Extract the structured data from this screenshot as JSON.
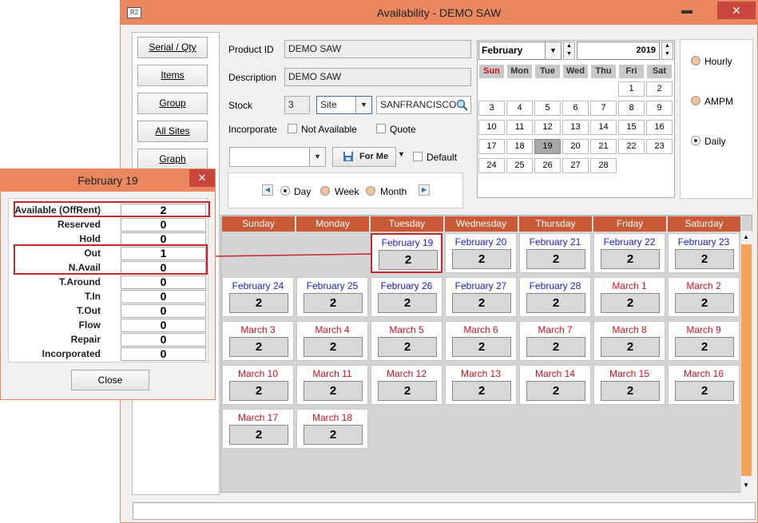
{
  "window": {
    "title": "Availability - DEMO SAW",
    "logo": "R2",
    "minimize_icon": "minimize-icon",
    "close_icon": "close-icon"
  },
  "nav": [
    "Serial / Qty",
    "Items",
    "Group",
    "All Sites",
    "Graph"
  ],
  "info": {
    "product_id_label": "Product ID",
    "product_id": "DEMO SAW",
    "description_label": "Description",
    "description": "DEMO SAW",
    "stock_label": "Stock",
    "stock_qty": "3",
    "stock_type": "Site",
    "stock_site": "SANFRANCISCO",
    "incorporate_label": "Incorporate",
    "not_available_label": "Not Available",
    "quote_label": "Quote",
    "for_me_label": "For Me",
    "default_label": "Default"
  },
  "view": {
    "day": "Day",
    "week": "Week",
    "month": "Month",
    "selected": "Day"
  },
  "mini_calendar": {
    "month": "February",
    "year": "2019",
    "weekdays": [
      "Sun",
      "Mon",
      "Tue",
      "Wed",
      "Thu",
      "Fri",
      "Sat"
    ],
    "days": [
      "1",
      "2",
      "3",
      "4",
      "5",
      "6",
      "7",
      "8",
      "9",
      "10",
      "11",
      "12",
      "13",
      "14",
      "15",
      "16",
      "17",
      "18",
      "19",
      "20",
      "21",
      "22",
      "23",
      "24",
      "25",
      "26",
      "27",
      "28"
    ],
    "first_weekday": 5,
    "selected_day": "19"
  },
  "modes": {
    "hourly": "Hourly",
    "ampm": "AMPM",
    "daily": "Daily",
    "selected": "Daily"
  },
  "calendar": {
    "headers": [
      "Sunday",
      "Monday",
      "Tuesday",
      "Wednesday",
      "Thursday",
      "Friday",
      "Saturday"
    ],
    "weeks": [
      [
        null,
        null,
        {
          "date": "February 19",
          "value": "2",
          "color": "blue",
          "highlight": true
        },
        {
          "date": "February 20",
          "value": "2",
          "color": "blue"
        },
        {
          "date": "February 21",
          "value": "2",
          "color": "blue"
        },
        {
          "date": "February 22",
          "value": "2",
          "color": "blue"
        },
        {
          "date": "February 23",
          "value": "2",
          "color": "blue"
        }
      ],
      [
        {
          "date": "February 24",
          "value": "2",
          "color": "blue"
        },
        {
          "date": "February 25",
          "value": "2",
          "color": "blue"
        },
        {
          "date": "February 26",
          "value": "2",
          "color": "blue"
        },
        {
          "date": "February 27",
          "value": "2",
          "color": "blue"
        },
        {
          "date": "February 28",
          "value": "2",
          "color": "blue"
        },
        {
          "date": "March 1",
          "value": "2",
          "color": "red"
        },
        {
          "date": "March 2",
          "value": "2",
          "color": "red"
        }
      ],
      [
        {
          "date": "March 3",
          "value": "2",
          "color": "red"
        },
        {
          "date": "March 4",
          "value": "2",
          "color": "red"
        },
        {
          "date": "March 5",
          "value": "2",
          "color": "red"
        },
        {
          "date": "March 6",
          "value": "2",
          "color": "red"
        },
        {
          "date": "March 7",
          "value": "2",
          "color": "red"
        },
        {
          "date": "March 8",
          "value": "2",
          "color": "red"
        },
        {
          "date": "March 9",
          "value": "2",
          "color": "red"
        }
      ],
      [
        {
          "date": "March 10",
          "value": "2",
          "color": "red"
        },
        {
          "date": "March 11",
          "value": "2",
          "color": "red"
        },
        {
          "date": "March 12",
          "value": "2",
          "color": "red"
        },
        {
          "date": "March 13",
          "value": "2",
          "color": "red"
        },
        {
          "date": "March 14",
          "value": "2",
          "color": "red"
        },
        {
          "date": "March 15",
          "value": "2",
          "color": "red"
        },
        {
          "date": "March 16",
          "value": "2",
          "color": "red"
        }
      ],
      [
        {
          "date": "March 17",
          "value": "2",
          "color": "red"
        },
        {
          "date": "March 18",
          "value": "2",
          "color": "red"
        },
        null,
        null,
        null,
        null,
        null
      ]
    ]
  },
  "popup": {
    "title": "February 19",
    "rows": [
      {
        "label": "Available (OffRent)",
        "value": "2",
        "boxed": true
      },
      {
        "label": "Reserved",
        "value": "0"
      },
      {
        "label": "Hold",
        "value": "0"
      },
      {
        "label": "Out",
        "value": "1"
      },
      {
        "label": "N.Avail",
        "value": "0"
      },
      {
        "label": "T.Around",
        "value": "0"
      },
      {
        "label": "T.In",
        "value": "0"
      },
      {
        "label": "T.Out",
        "value": "0"
      },
      {
        "label": "Flow",
        "value": "0"
      },
      {
        "label": "Repair",
        "value": "0"
      },
      {
        "label": "Incorporated",
        "value": "0"
      }
    ],
    "close_label": "Close"
  },
  "colors": {
    "accent": "#e9875e",
    "header": "#c95a35",
    "highlight": "#c0282c"
  }
}
